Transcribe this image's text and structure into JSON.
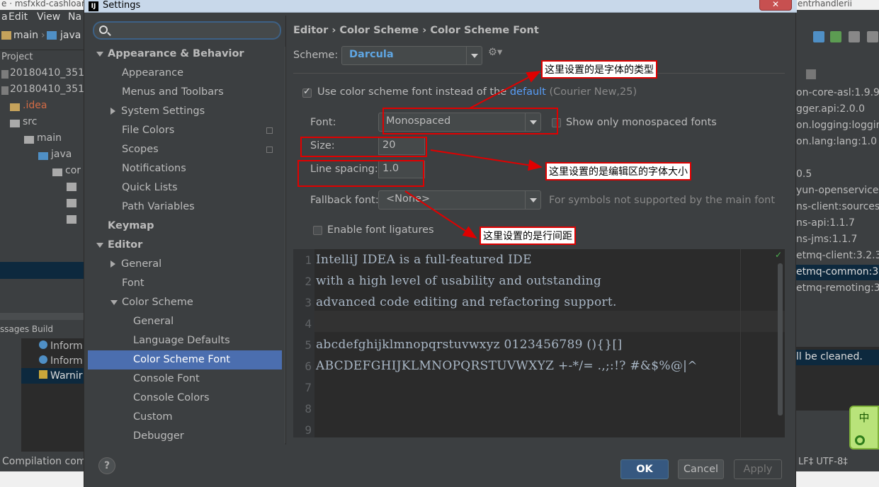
{
  "bg_ide": {
    "menu": [
      "a",
      "Edit",
      "View",
      "Na"
    ],
    "top_title_left": "e · msfxkd-cashloan",
    "top_title_right": "entrhandlerii",
    "nav": [
      "main",
      "java"
    ],
    "project_head": "Project",
    "tree": [
      "20180410_3511",
      "20180410_3511",
      ".idea",
      "src",
      "main",
      "java",
      "cor"
    ],
    "messages_head": "ssages Build",
    "messages": [
      "Inform",
      "Inform",
      "Warnir"
    ],
    "status_left": "Compilation com",
    "right_libs": [
      "on-core-asl:1.9.9",
      "gger.api:2.0.0",
      "on.logging:logging",
      "on.lang:lang:1.0",
      "0.5",
      "yun-openservices",
      "ns-client:sources:1",
      "ns-api:1.1.7",
      "ns-jms:1.1.7",
      "etmq-client:3.2.3",
      "etmq-common:3.",
      "etmq-remoting:3"
    ],
    "right_cleaned": "ll be cleaned.",
    "status_right": "LF‡ UTF-8‡",
    "ime_char": "中"
  },
  "dialog": {
    "title": "Settings",
    "title_icon": "IJ",
    "close": "✕",
    "search_placeholder": "",
    "tree": [
      {
        "label": "Appearance & Behavior",
        "level": 0,
        "bold": true,
        "arrow": "down"
      },
      {
        "label": "Appearance",
        "level": 1
      },
      {
        "label": "Menus and Toolbars",
        "level": 1
      },
      {
        "label": "System Settings",
        "level": 1,
        "arrow": "right"
      },
      {
        "label": "File Colors",
        "level": 1,
        "copy": true
      },
      {
        "label": "Scopes",
        "level": 1,
        "copy": true
      },
      {
        "label": "Notifications",
        "level": 1
      },
      {
        "label": "Quick Lists",
        "level": 1
      },
      {
        "label": "Path Variables",
        "level": 1
      },
      {
        "label": "Keymap",
        "level": 0,
        "bold": true
      },
      {
        "label": "Editor",
        "level": 0,
        "bold": true,
        "arrow": "down"
      },
      {
        "label": "General",
        "level": 1,
        "arrow": "right"
      },
      {
        "label": "Font",
        "level": 1
      },
      {
        "label": "Color Scheme",
        "level": 1,
        "arrow": "down"
      },
      {
        "label": "General",
        "level": 2
      },
      {
        "label": "Language Defaults",
        "level": 2
      },
      {
        "label": "Color Scheme Font",
        "level": 2,
        "selected": true
      },
      {
        "label": "Console Font",
        "level": 2
      },
      {
        "label": "Console Colors",
        "level": 2
      },
      {
        "label": "Custom",
        "level": 2
      },
      {
        "label": "Debugger",
        "level": 2
      }
    ],
    "breadcrumb": "Editor › Color Scheme › Color Scheme Font",
    "scheme_label": "Scheme:",
    "scheme_value": "Darcula",
    "gear": "⚙▾",
    "use_scheme_font_pre": "Use color scheme font instead of the ",
    "use_scheme_font_link": "default",
    "use_scheme_font_post": " (Courier New,25)",
    "font_label": "Font:",
    "font_value": "Monospaced",
    "show_mono_label": "Show only monospaced fonts",
    "size_label": "Size:",
    "size_value": "20",
    "line_spacing_label": "Line spacing:",
    "line_spacing_value": "1.0",
    "fallback_label": "Fallback font:",
    "fallback_value": "<None>",
    "fallback_hint": "For symbols not supported by the main font",
    "ligatures_label": "Enable font ligatures",
    "preview_lines": [
      "IntelliJ IDEA is a full-featured IDE",
      "with a high level of usability and outstanding",
      "advanced code editing and refactoring support.",
      "",
      "abcdefghijklmnopqrstuvwxyz 0123456789 (){}[]",
      "ABCDEFGHIJKLMNOPQRSTUVWXYZ +-*/= .,;:!? #&$%@|^",
      "",
      "",
      ""
    ],
    "line_numbers": [
      "1",
      "2",
      "3",
      "4",
      "5",
      "6",
      "7",
      "8",
      "9"
    ],
    "ok": "OK",
    "cancel": "Cancel",
    "apply": "Apply",
    "help": "?"
  },
  "annotations": {
    "font_type": "这里设置的是字体的类型",
    "font_size": "这里设置的是编辑区的字体大小",
    "line_spacing": "这里设置的是行间距",
    "color": "#e00000"
  }
}
